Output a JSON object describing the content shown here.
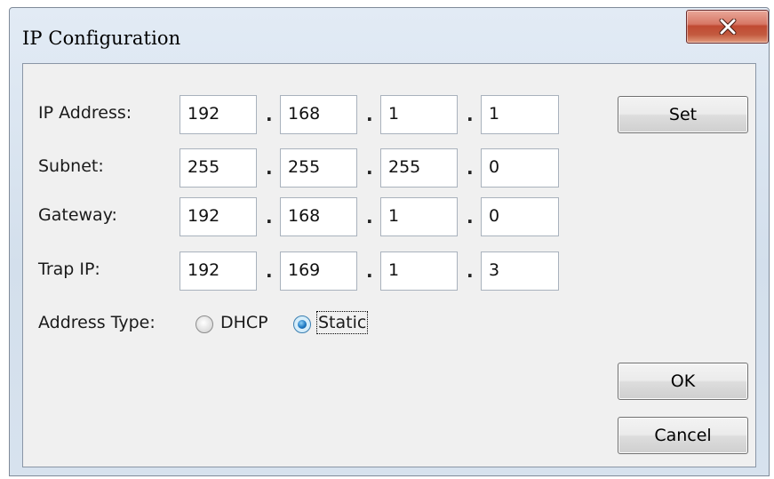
{
  "window": {
    "title": "IP Configuration",
    "close_icon": "close-x-icon"
  },
  "rows": [
    {
      "label": "IP Address:",
      "octets": [
        "192",
        "168",
        "1",
        "1"
      ]
    },
    {
      "label": "Subnet:",
      "octets": [
        "255",
        "255",
        "255",
        "0"
      ]
    },
    {
      "label": "Gateway:",
      "octets": [
        "192",
        "168",
        "1",
        "0"
      ]
    },
    {
      "label": "Trap IP:",
      "octets": [
        "192",
        "169",
        "1",
        "3"
      ]
    }
  ],
  "separator": ".",
  "address_type": {
    "label": "Address Type:",
    "options": [
      "DHCP",
      "Static"
    ],
    "selected": "Static"
  },
  "buttons": {
    "set": "Set",
    "ok": "OK",
    "cancel": "Cancel"
  },
  "colors": {
    "close_button": "#c9553d",
    "radio_selected": "#1f79c2"
  }
}
